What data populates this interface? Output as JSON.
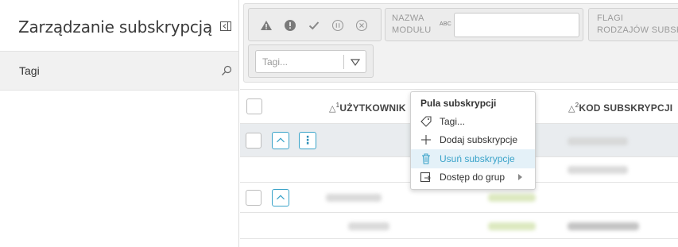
{
  "sidebar": {
    "title": "Zarządzanie subskrypcją",
    "item_label": "Tagi"
  },
  "filters": {
    "status_icons": [
      "warning-icon",
      "error-icon",
      "check-icon",
      "pause-icon",
      "cancel-icon"
    ],
    "module_name_label_1": "NAZWA",
    "module_name_label_2": "MODUŁU",
    "abc_label": "ABC",
    "module_name_value": "",
    "flags_label_1": "FLAGI",
    "flags_label_2": "RODZAJÓW SUBSK",
    "tags_placeholder": "Tagi..."
  },
  "grid": {
    "columns": [
      {
        "sort_marker": "△",
        "order": "1",
        "label": "UŻYTKOWNIK"
      },
      {
        "sort_marker": "△",
        "order": "2",
        "label": "KOD SUBSKRYPCJI"
      }
    ],
    "dots_label": "⋮"
  },
  "context_menu": {
    "title": "Pula subskrypcji",
    "items": [
      {
        "label": "Tagi...",
        "icon": "tag-icon"
      },
      {
        "label": "Dodaj subskrypcje",
        "icon": "plus-icon"
      },
      {
        "label": "Usuń subskrypcje",
        "icon": "trash-icon",
        "active": true
      },
      {
        "label": "Dostęp do grup",
        "icon": "share-icon",
        "submenu": true
      }
    ]
  },
  "colors": {
    "accent": "#3aa3c9",
    "selected_row": "#e9ecef",
    "menu_active_bg": "#e4f1f8"
  }
}
